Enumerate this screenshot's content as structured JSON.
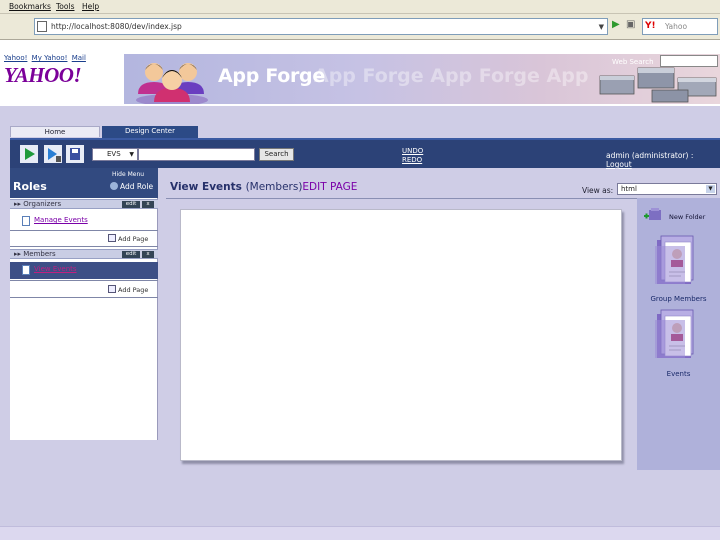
{
  "browser": {
    "menu": [
      "Bookmarks",
      "Tools",
      "Help"
    ],
    "url": "http://localhost:8080/dev/index.jsp",
    "search_placeholder": "Yahoo",
    "search_badge": "Y!"
  },
  "yahoo": {
    "links": [
      "Yahoo!",
      "My Yahoo!",
      "Mail"
    ],
    "logo": "YAHOO!",
    "web_search_label": "Web Search"
  },
  "banner": {
    "title": "App Forge",
    "ghost_text": "App Forge App Forge App"
  },
  "tabs": [
    {
      "label": "Home"
    },
    {
      "label": "Design Center"
    }
  ],
  "toolbar": {
    "select_value": "EVS",
    "search_label": "Search",
    "undo": "UNDO",
    "redo": "REDO",
    "user": "admin (administrator) :",
    "logout": "Logout"
  },
  "left_panel": {
    "hide_menu": "Hide Menu",
    "title": "Roles",
    "add_role": "Add Role",
    "roles": [
      {
        "name": "Organizers",
        "edit": "edit",
        "remove": "x",
        "pages": [
          "Manage Events"
        ],
        "add_page": "Add Page"
      },
      {
        "name": "Members",
        "edit": "edit",
        "remove": "x",
        "pages": [
          "View Events"
        ],
        "add_page": "Add Page"
      }
    ]
  },
  "main": {
    "title": "View Events",
    "role": "(Members)",
    "edit_page": "EDIT PAGE",
    "view_as_label": "View as:",
    "view_as_value": "html"
  },
  "right_panel": {
    "new_folder": "New Folder",
    "folders": [
      {
        "label": "Group Members"
      },
      {
        "label": "Events"
      }
    ]
  },
  "colors": {
    "toolbar": "#2c4277",
    "accent_purple": "#7a00a8",
    "yahoo_purple": "#7b0099",
    "background": "#cfcde6"
  }
}
